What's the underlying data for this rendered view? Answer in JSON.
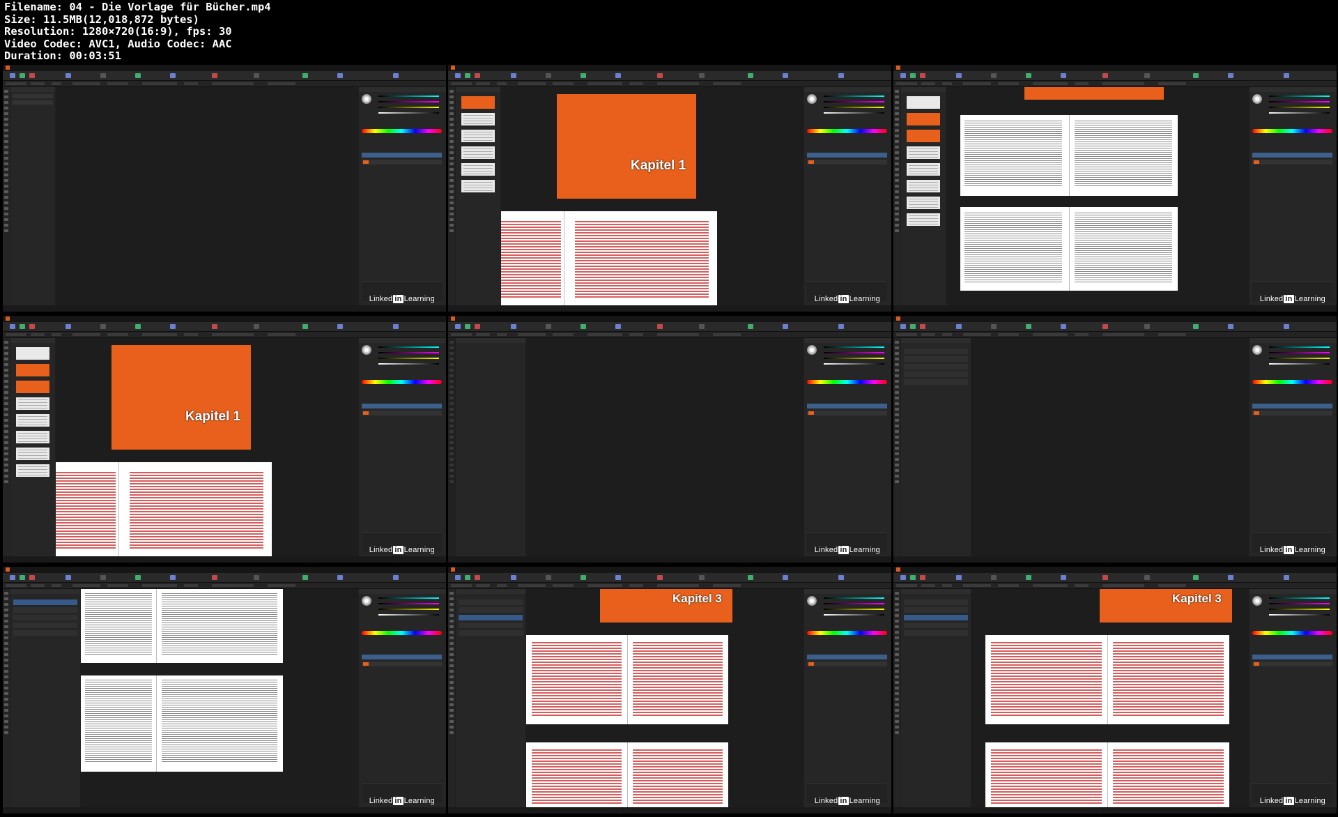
{
  "file_info": {
    "filename": "Filename: 04 - Die Vorlage für Bücher.mp4",
    "size": "Size: 11.5MB(12,018,872 bytes)",
    "resolution": "Resolution: 1280×720(16:9), fps: 30",
    "codec": "Video Codec: AVC1, Audio Codec: AAC",
    "duration": "Duration: 00:03:51"
  },
  "watermark": {
    "pre": "Linked",
    "box": "in",
    "post": "Learning"
  },
  "chapter_labels": [
    "Kapitel 1",
    "Kapitel 1",
    "Kapitel 3",
    "Kapitel 3"
  ],
  "colors": {
    "accent": "#e8601c",
    "ui_dark": "#1f1f1f",
    "selection": "#3c5f8c"
  },
  "thumbnails": [
    {
      "id": 1,
      "variant": "empty-pages-panel"
    },
    {
      "id": 2,
      "variant": "chapter-cover-with-spread"
    },
    {
      "id": 3,
      "variant": "text-spreads-gray"
    },
    {
      "id": 4,
      "variant": "chapter-cover-with-spread-master"
    },
    {
      "id": 5,
      "variant": "book-panel-empty"
    },
    {
      "id": 6,
      "variant": "book-chapter-list"
    },
    {
      "id": 7,
      "variant": "book-list-text-spreads"
    },
    {
      "id": 8,
      "variant": "kapitel-3-red-spreads"
    },
    {
      "id": 9,
      "variant": "kapitel-3-red-spreads-wide"
    }
  ]
}
